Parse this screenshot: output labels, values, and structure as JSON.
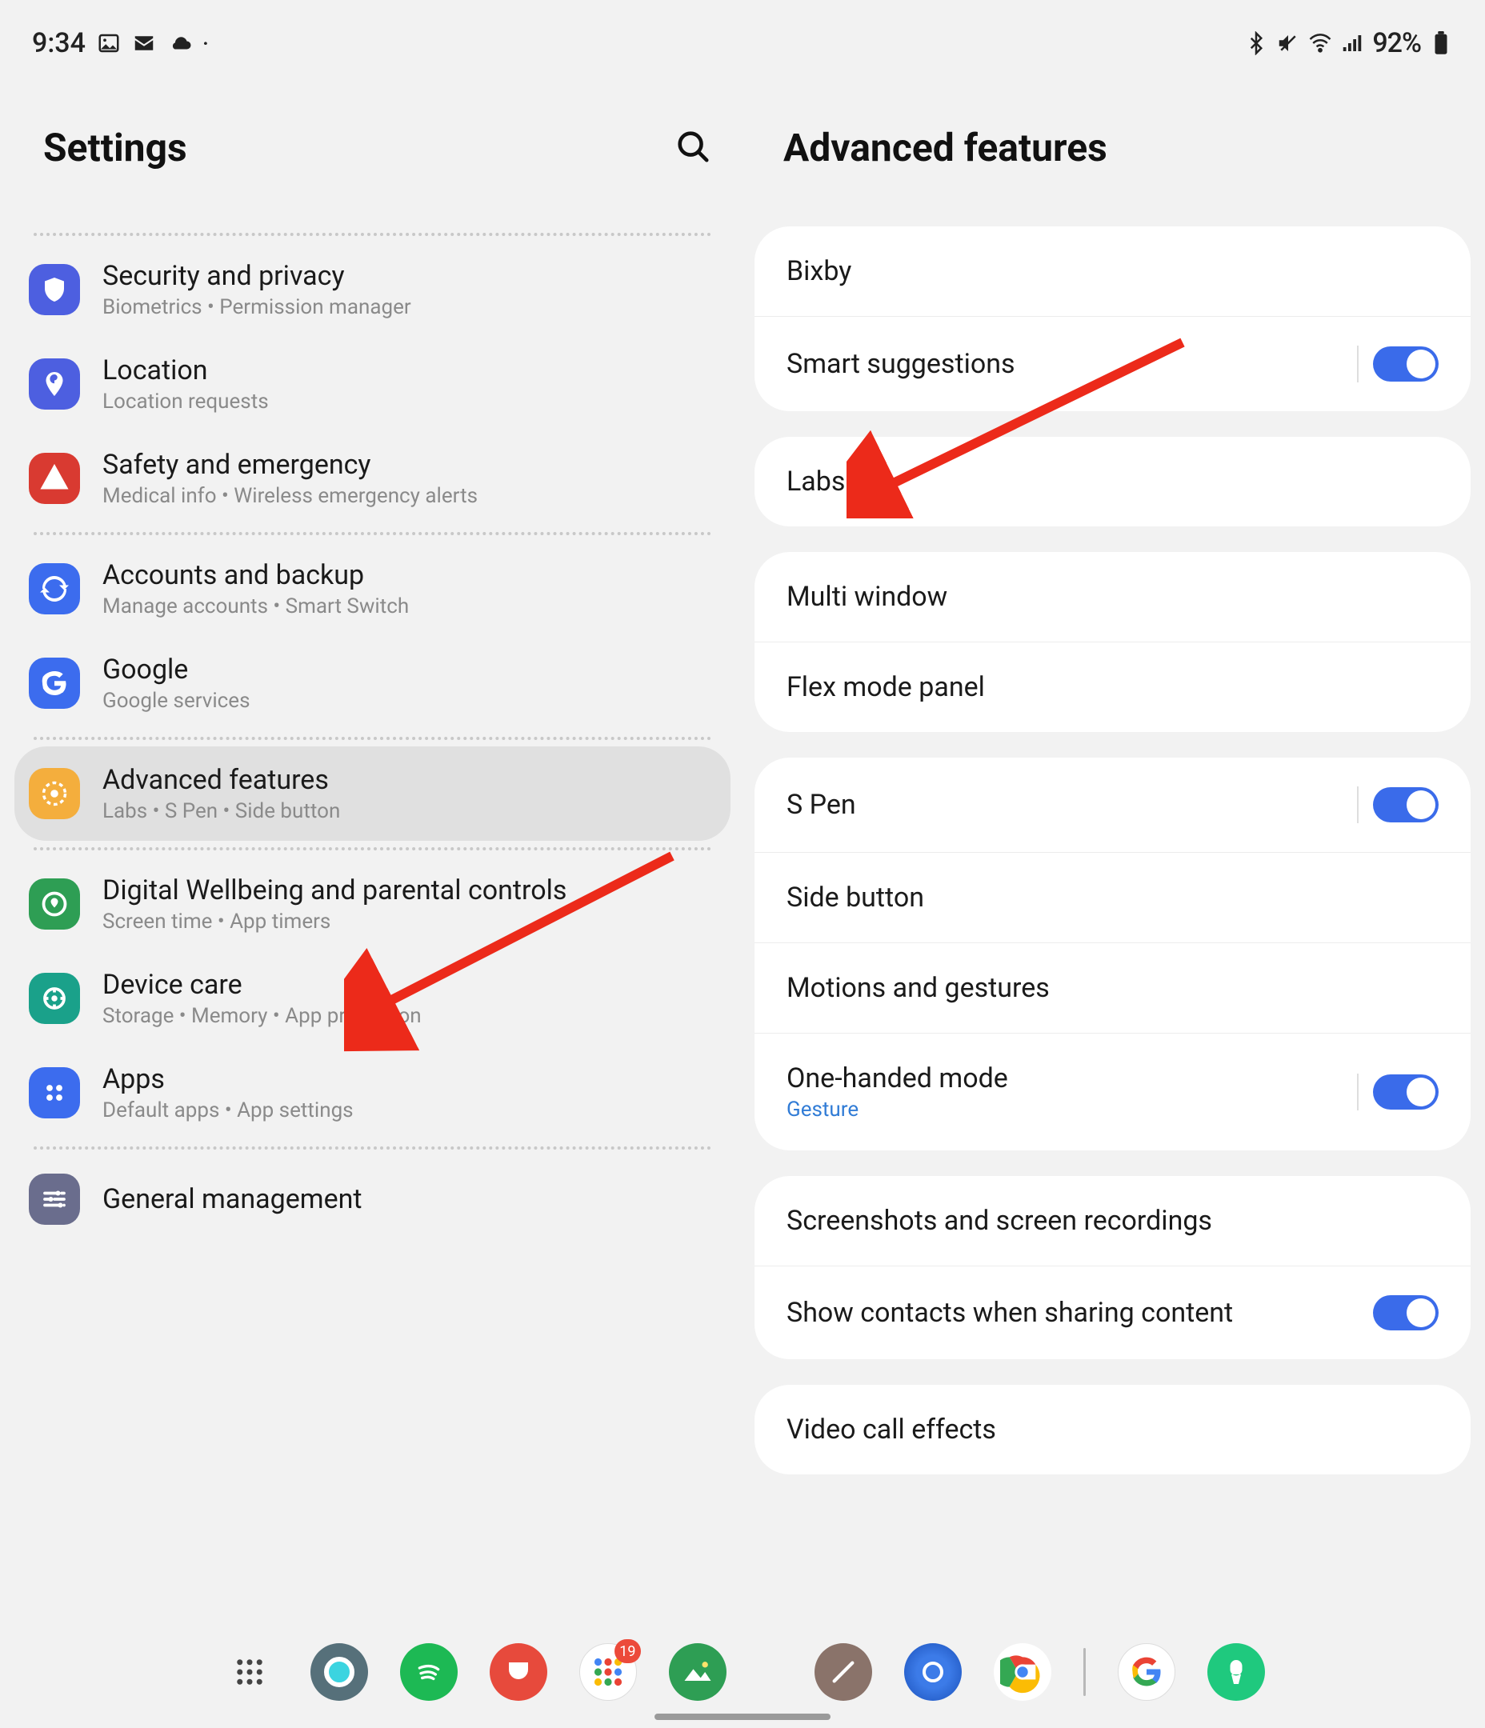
{
  "status": {
    "time": "9:34",
    "battery_pct": "92%"
  },
  "left": {
    "title": "Settings",
    "items": [
      {
        "id": "security",
        "title": "Security and privacy",
        "sub": "Biometrics  •  Permission manager",
        "icon": "shield",
        "color": "#4d5fe0"
      },
      {
        "id": "location",
        "title": "Location",
        "sub": "Location requests",
        "icon": "pin",
        "color": "#4d5fe0"
      },
      {
        "id": "safety",
        "title": "Safety and emergency",
        "sub": "Medical info  •  Wireless emergency alerts",
        "icon": "alert",
        "color": "#d93a31"
      },
      {
        "sep": true
      },
      {
        "id": "accounts",
        "title": "Accounts and backup",
        "sub": "Manage accounts  •  Smart Switch",
        "icon": "sync",
        "color": "#3c6cee"
      },
      {
        "id": "google",
        "title": "Google",
        "sub": "Google services",
        "icon": "google",
        "color": "#3c6cee"
      },
      {
        "sep": true
      },
      {
        "id": "advanced",
        "title": "Advanced features",
        "sub": "Labs  •  S Pen  •  Side button",
        "icon": "gearplus",
        "color": "#f4ae3d",
        "selected": true
      },
      {
        "sep": true
      },
      {
        "id": "wellbeing",
        "title": "Digital Wellbeing and parental controls",
        "sub": "Screen time  •  App timers",
        "icon": "wellbeing",
        "color": "#2e9e54"
      },
      {
        "id": "device",
        "title": "Device care",
        "sub": "Storage  •  Memory  •  App protection",
        "icon": "care",
        "color": "#1aa18a"
      },
      {
        "id": "apps",
        "title": "Apps",
        "sub": "Default apps  •  App settings",
        "icon": "apps",
        "color": "#3c6cee"
      },
      {
        "sep": true
      },
      {
        "id": "general",
        "title": "General management",
        "sub": "",
        "icon": "sliders",
        "color": "#6a6d8d"
      }
    ]
  },
  "right": {
    "title": "Advanced features",
    "groups": [
      [
        {
          "id": "bixby",
          "label": "Bixby"
        },
        {
          "id": "smart",
          "label": "Smart suggestions",
          "toggle": true,
          "toggleSep": true
        }
      ],
      [
        {
          "id": "labs",
          "label": "Labs"
        }
      ],
      [
        {
          "id": "multi",
          "label": "Multi window"
        },
        {
          "id": "flex",
          "label": "Flex mode panel"
        }
      ],
      [
        {
          "id": "spen",
          "label": "S Pen",
          "toggle": true,
          "toggleSep": true
        },
        {
          "id": "side",
          "label": "Side button"
        },
        {
          "id": "motions",
          "label": "Motions and gestures"
        },
        {
          "id": "onehand",
          "label": "One-handed mode",
          "sub": "Gesture",
          "toggle": true,
          "toggleSep": true
        }
      ],
      [
        {
          "id": "shots",
          "label": "Screenshots and screen recordings"
        },
        {
          "id": "contacts",
          "label": "Show contacts when sharing content",
          "toggle": true
        }
      ],
      [
        {
          "id": "video",
          "label": "Video call effects"
        }
      ]
    ]
  },
  "taskbar": {
    "badge": "19"
  }
}
